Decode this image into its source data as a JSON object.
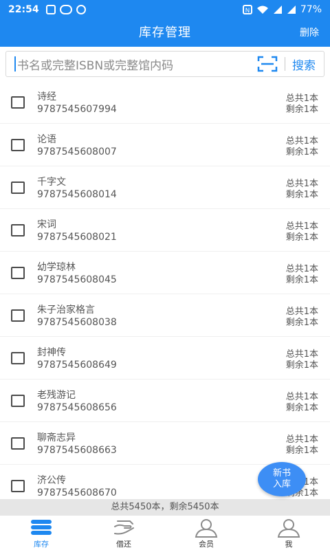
{
  "status_bar": {
    "time": "22:54",
    "battery": "77%"
  },
  "header": {
    "title": "库存管理",
    "delete_label": "删除"
  },
  "search": {
    "placeholder": "书名或完整ISBN或完整馆内码",
    "search_label": "搜索"
  },
  "books": [
    {
      "name": "诗经",
      "isbn": "9787545607994",
      "total": "总共1本",
      "remaining": "剩余1本"
    },
    {
      "name": "论语",
      "isbn": "9787545608007",
      "total": "总共1本",
      "remaining": "剩余1本"
    },
    {
      "name": "千字文",
      "isbn": "9787545608014",
      "total": "总共1本",
      "remaining": "剩余1本"
    },
    {
      "name": "宋词",
      "isbn": "9787545608021",
      "total": "总共1本",
      "remaining": "剩余1本"
    },
    {
      "name": "幼学琼林",
      "isbn": "9787545608045",
      "total": "总共1本",
      "remaining": "剩余1本"
    },
    {
      "name": "朱子治家格言",
      "isbn": "9787545608038",
      "total": "总共1本",
      "remaining": "剩余1本"
    },
    {
      "name": "封神传",
      "isbn": "9787545608649",
      "total": "总共1本",
      "remaining": "剩余1本"
    },
    {
      "name": "老残游记",
      "isbn": "9787545608656",
      "total": "总共1本",
      "remaining": "剩余1本"
    },
    {
      "name": "聊斋志异",
      "isbn": "9787545608663",
      "total": "总共1本",
      "remaining": "剩余1本"
    },
    {
      "name": "济公传",
      "isbn": "9787545608670",
      "total": "总共1本",
      "remaining": "剩余1本"
    }
  ],
  "summary": "总共5450本，剩余5450本",
  "fab": {
    "line1": "新书",
    "line2": "入库"
  },
  "tabs": [
    {
      "label": "库存",
      "icon": "inventory-icon",
      "active": true
    },
    {
      "label": "借还",
      "icon": "borrow-return-icon",
      "active": false
    },
    {
      "label": "会员",
      "icon": "member-icon",
      "active": false
    },
    {
      "label": "我",
      "icon": "profile-icon",
      "active": false
    }
  ],
  "colors": {
    "primary": "#1e88f0",
    "fab": "#3d8ef5"
  }
}
